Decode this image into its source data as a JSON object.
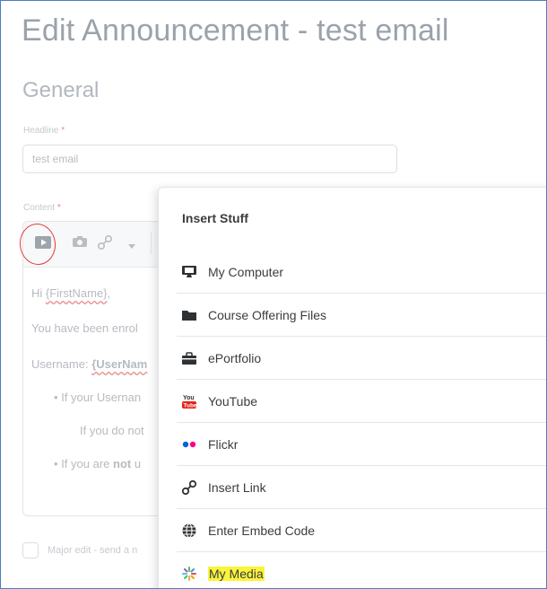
{
  "page": {
    "title": "Edit Announcement - test email",
    "section": "General"
  },
  "headline": {
    "label": "Headline",
    "required_mark": "*",
    "value": "test email"
  },
  "content": {
    "label": "Content",
    "required_mark": "*",
    "toolbar": [
      {
        "icon": "insert-stuff-icon"
      },
      {
        "icon": "camera-icon"
      },
      {
        "icon": "link-icon"
      },
      {
        "icon": "chevron-down-icon"
      }
    ],
    "lines": {
      "greeting_prefix": "Hi ",
      "greeting_var": "{FirstName}",
      "greeting_suffix": ",",
      "enrolled": "You have been enrol",
      "username_prefix": "Username: ",
      "username_var": "{UserNam",
      "bullet1": "If your Usernan",
      "bullet1_sub": "If you do not",
      "bullet2_prefix": "If you are ",
      "bullet2_bold": "not",
      "bullet2_suffix": " u"
    }
  },
  "major_edit": {
    "label": "Major edit - send a n"
  },
  "insert_stuff": {
    "title": "Insert Stuff",
    "items": [
      {
        "label": "My Computer",
        "icon": "computer-icon"
      },
      {
        "label": "Course Offering Files",
        "icon": "folder-icon"
      },
      {
        "label": "ePortfolio",
        "icon": "briefcase-icon"
      },
      {
        "label": "YouTube",
        "icon": "youtube-icon"
      },
      {
        "label": "Flickr",
        "icon": "flickr-icon"
      },
      {
        "label": "Insert Link",
        "icon": "link-icon"
      },
      {
        "label": "Enter Embed Code",
        "icon": "globe-icon"
      },
      {
        "label": "My Media",
        "icon": "kaltura-icon",
        "highlighted": true
      }
    ]
  },
  "colors": {
    "highlight": "#fbf33c",
    "annotation_circle": "#e53b3b",
    "frame_border": "#4a7fc1",
    "flickr_blue": "#0063dc",
    "flickr_pink": "#ff0084",
    "youtube_red": "#e62117"
  }
}
